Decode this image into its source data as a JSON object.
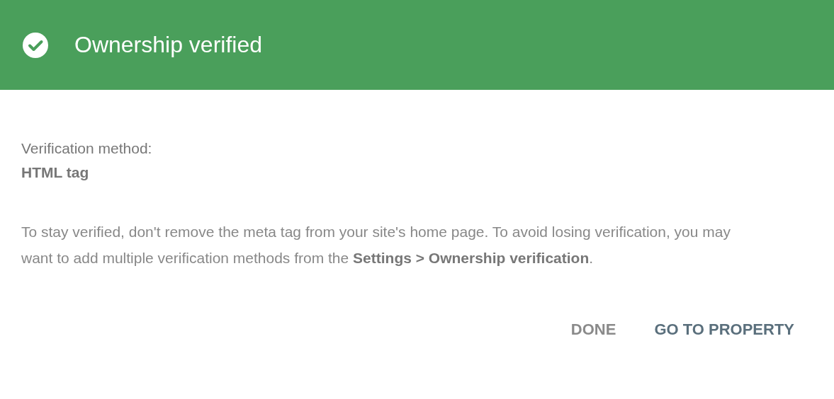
{
  "header": {
    "title": "Ownership verified"
  },
  "method": {
    "label": "Verification method:",
    "value": "HTML tag"
  },
  "message": "To stay verified, don't remove the meta tag from your site's home page. To avoid losing verification, you may want to add multiple verification methods from the **Settings > Ownership verification**.",
  "buttons": [
    {
      "label": "DONE",
      "kind": "secondary"
    },
    {
      "label": "GO TO PROPERTY",
      "kind": "primary"
    }
  ]
}
